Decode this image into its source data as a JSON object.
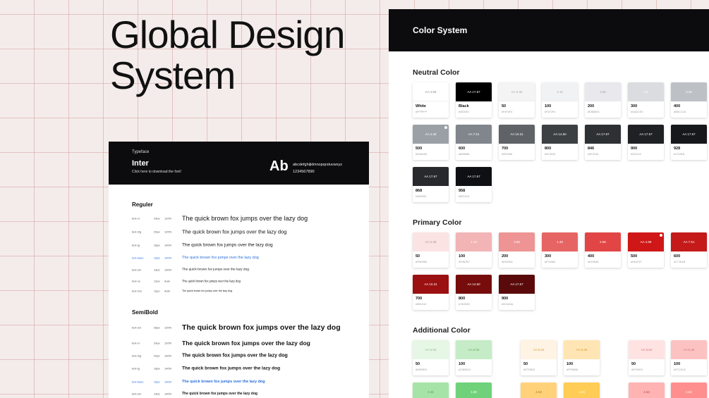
{
  "hero": {
    "line1": "Global Design",
    "line2": "System"
  },
  "typeface": {
    "label": "Typeface",
    "name": "Inter",
    "link": "Click here to download the font!",
    "sample": "Ab",
    "alphabet": "abcdefghijklmnopqrstuvwxyz",
    "digits": "1234567890"
  },
  "regular": {
    "title": "Reguler",
    "rows": [
      {
        "name": "text-xl",
        "px": "24px",
        "lh": "120%",
        "sample": "The quick brown fox jumps over the lazy dog"
      },
      {
        "name": "text-2lg",
        "px": "20px",
        "lh": "120%",
        "sample": "The quick brown fox jumps over the lazy dog"
      },
      {
        "name": "text-lg",
        "px": "18px",
        "lh": "140%",
        "sample": "The quick brown fox jumps over the lazy dog"
      },
      {
        "name": "text-base",
        "px": "16px",
        "lh": "140%",
        "sample": "The quick brown fox jumps over the lazy dog"
      },
      {
        "name": "text-sm",
        "px": "14px",
        "lh": "140%",
        "sample": "The quick brown fox jumps over the lazy dog"
      },
      {
        "name": "text-xs",
        "px": "12px",
        "lh": "Auto",
        "sample": "The quick brown fox jumps over the lazy dog"
      },
      {
        "name": "text-2xs",
        "px": "11px",
        "lh": "Auto",
        "sample": "The quick brown fox jumps over the lazy dog"
      }
    ]
  },
  "semibold": {
    "title": "SemiBold",
    "rows": [
      {
        "name": "text-2xl",
        "px": "28px",
        "lh": "120%",
        "sample": "The quick brown fox jumps over the lazy dog"
      },
      {
        "name": "text-xl",
        "px": "24px",
        "lh": "120%",
        "sample": "The quick brown fox jumps over the lazy dog"
      },
      {
        "name": "text-2lg",
        "px": "20px",
        "lh": "140%",
        "sample": "The quick brown fox jumps over the lazy dog"
      },
      {
        "name": "text-lg",
        "px": "18px",
        "lh": "140%",
        "sample": "The quick brown fox jumps over the lazy dog"
      },
      {
        "name": "text-base",
        "px": "16px",
        "lh": "140%",
        "sample": "The quick brown fox jumps over the lazy dog"
      },
      {
        "name": "text-sm",
        "px": "14px",
        "lh": "140%",
        "sample": "The quick brown fox jumps over the lazy dog"
      }
    ]
  },
  "colors": {
    "title": "Color  System",
    "neutral": {
      "title": "Neutral Color",
      "swatches": [
        {
          "name": "White",
          "hex": "#FFFFFF",
          "aa": "AA 4.59",
          "color": "#ffffff",
          "text": "#888888"
        },
        {
          "name": "Black",
          "hex": "#000000",
          "aa": "AA 17.67",
          "color": "#000000",
          "text": "#ffffff"
        },
        {
          "name": "50",
          "hex": "#F4F4F4",
          "aa": "AA 4.49",
          "color": "#f4f4f4",
          "text": "#aaaaaa"
        },
        {
          "name": "100",
          "hex": "#F1F2F4",
          "aa": "4.16",
          "color": "#f1f2f4",
          "text": "#aaaaaa"
        },
        {
          "name": "200",
          "hex": "#E8E8ED",
          "aa": "3.65",
          "color": "#e8e8ed",
          "text": "#aaaaaa"
        },
        {
          "name": "300",
          "hex": "#DADCE0",
          "aa": "3.6",
          "color": "#dadce0",
          "text": "#ffffff"
        },
        {
          "name": "400",
          "hex": "#BDC1C6",
          "aa": "3.35",
          "color": "#bdc1c6",
          "text": "#ffffff"
        },
        {
          "name": "500",
          "hex": "#9AA0A6",
          "aa": "AA 4.48",
          "color": "#9aa0a6",
          "text": "#ffffff",
          "dot": true
        },
        {
          "name": "600",
          "hex": "#80868B",
          "aa": "AA 7.51",
          "color": "#80868b",
          "text": "#ffffff"
        },
        {
          "name": "700",
          "hex": "#5F6368",
          "aa": "AA 10.31",
          "color": "#5f6368",
          "text": "#ffffff"
        },
        {
          "name": "800",
          "hex": "#3C4043",
          "aa": "AA 14.60",
          "color": "#3c4043",
          "text": "#ffffff"
        },
        {
          "name": "846",
          "hex": "#2E3134",
          "aa": "AA 17.67",
          "color": "#2e3134",
          "text": "#ffffff"
        },
        {
          "name": "900",
          "hex": "#202124",
          "aa": "AA 17.67",
          "color": "#202124",
          "text": "#ffffff"
        },
        {
          "name": "928",
          "hex": "#17181B",
          "aa": "AA 17.67",
          "color": "#17181b",
          "text": "#ffffff"
        },
        {
          "name": "868",
          "hex": "#28292D",
          "aa": "AA 17.67",
          "color": "#28292d",
          "text": "#ffffff"
        },
        {
          "name": "958",
          "hex": "#0E1014",
          "aa": "AA 17.67",
          "color": "#0e1014",
          "text": "#ffffff"
        }
      ]
    },
    "primary": {
      "title": "Primary Color",
      "swatches": [
        {
          "name": "50",
          "hex": "#FBE6E6",
          "aa": "AA 4.49",
          "color": "#fbe3e4",
          "text": "#999999"
        },
        {
          "name": "100",
          "hex": "#F0B7B7",
          "aa": "4.16",
          "color": "#f2b4b5",
          "text": "#ffffff"
        },
        {
          "name": "200",
          "hex": "#EE9494",
          "aa": "3.65",
          "color": "#ee9494",
          "text": "#ffffff"
        },
        {
          "name": "300",
          "hex": "#E76464",
          "aa": "1.48",
          "color": "#e76464",
          "text": "#ffffff"
        },
        {
          "name": "400",
          "hex": "#E24545",
          "aa": "2.55",
          "color": "#e24545",
          "text": "#ffffff"
        },
        {
          "name": "500",
          "hex": "#D81F1F",
          "aa": "AA 4.89",
          "color": "#d01717",
          "text": "#ffffff",
          "dot": true
        },
        {
          "name": "600",
          "hex": "#C71B1B",
          "aa": "AA 7.51",
          "color": "#c41a1a",
          "text": "#ffffff"
        },
        {
          "name": "700",
          "hex": "#9B1010",
          "aa": "AA 10.31",
          "color": "#9b1010",
          "text": "#ffffff"
        },
        {
          "name": "800",
          "hex": "#760D0D",
          "aa": "AA 14.60",
          "color": "#760c0c",
          "text": "#ffffff"
        },
        {
          "name": "900",
          "hex": "#5C0A0A",
          "aa": "AA 17.67",
          "color": "#5a0a0a",
          "text": "#ffffff"
        }
      ]
    },
    "additional": {
      "title": "Additional Color",
      "swatches": [
        {
          "name": "50",
          "hex": "#E8F9E8",
          "aa": "AA 5.53",
          "color": "#e6f7e5",
          "text": "#8ab88a"
        },
        {
          "name": "100",
          "hex": "#C9EBC9",
          "aa": "AA 5.53",
          "color": "#c5ecc6",
          "text": "#6aa86a"
        },
        {
          "name": "50",
          "hex": "#FFF6E8",
          "aa": "AA 6.04",
          "color": "#fff3e3",
          "text": "#d99a3a"
        },
        {
          "name": "100",
          "hex": "#FFE8B8",
          "aa": "AA 6.45",
          "color": "#ffe5b3",
          "text": "#d99a3a"
        },
        {
          "name": "50",
          "hex": "#FFE0E0",
          "aa": "AA 6.04",
          "color": "#ffe3e3",
          "text": "#d97070"
        },
        {
          "name": "100",
          "hex": "#FCC0C0",
          "aa": "AA 6.45",
          "color": "#fcc2c2",
          "text": "#d97070"
        },
        {
          "name": "",
          "hex": "",
          "aa": "4.45",
          "color": "#a6e3a6",
          "text": "#5c9a5c"
        },
        {
          "name": "",
          "hex": "",
          "aa": "1.80",
          "color": "#6fd27a",
          "text": "#ffffff"
        },
        {
          "name": "",
          "hex": "",
          "aa": "4.63",
          "color": "#ffd27a",
          "text": "#b07020"
        },
        {
          "name": "",
          "hex": "",
          "aa": "1.84",
          "color": "#ffcc55",
          "text": "#ffffff"
        },
        {
          "name": "",
          "hex": "",
          "aa": "4.63",
          "color": "#ffb3b3",
          "text": "#c24848"
        },
        {
          "name": "",
          "hex": "",
          "aa": "1.84",
          "color": "#ff8f8f",
          "text": "#ffffff"
        }
      ]
    }
  }
}
